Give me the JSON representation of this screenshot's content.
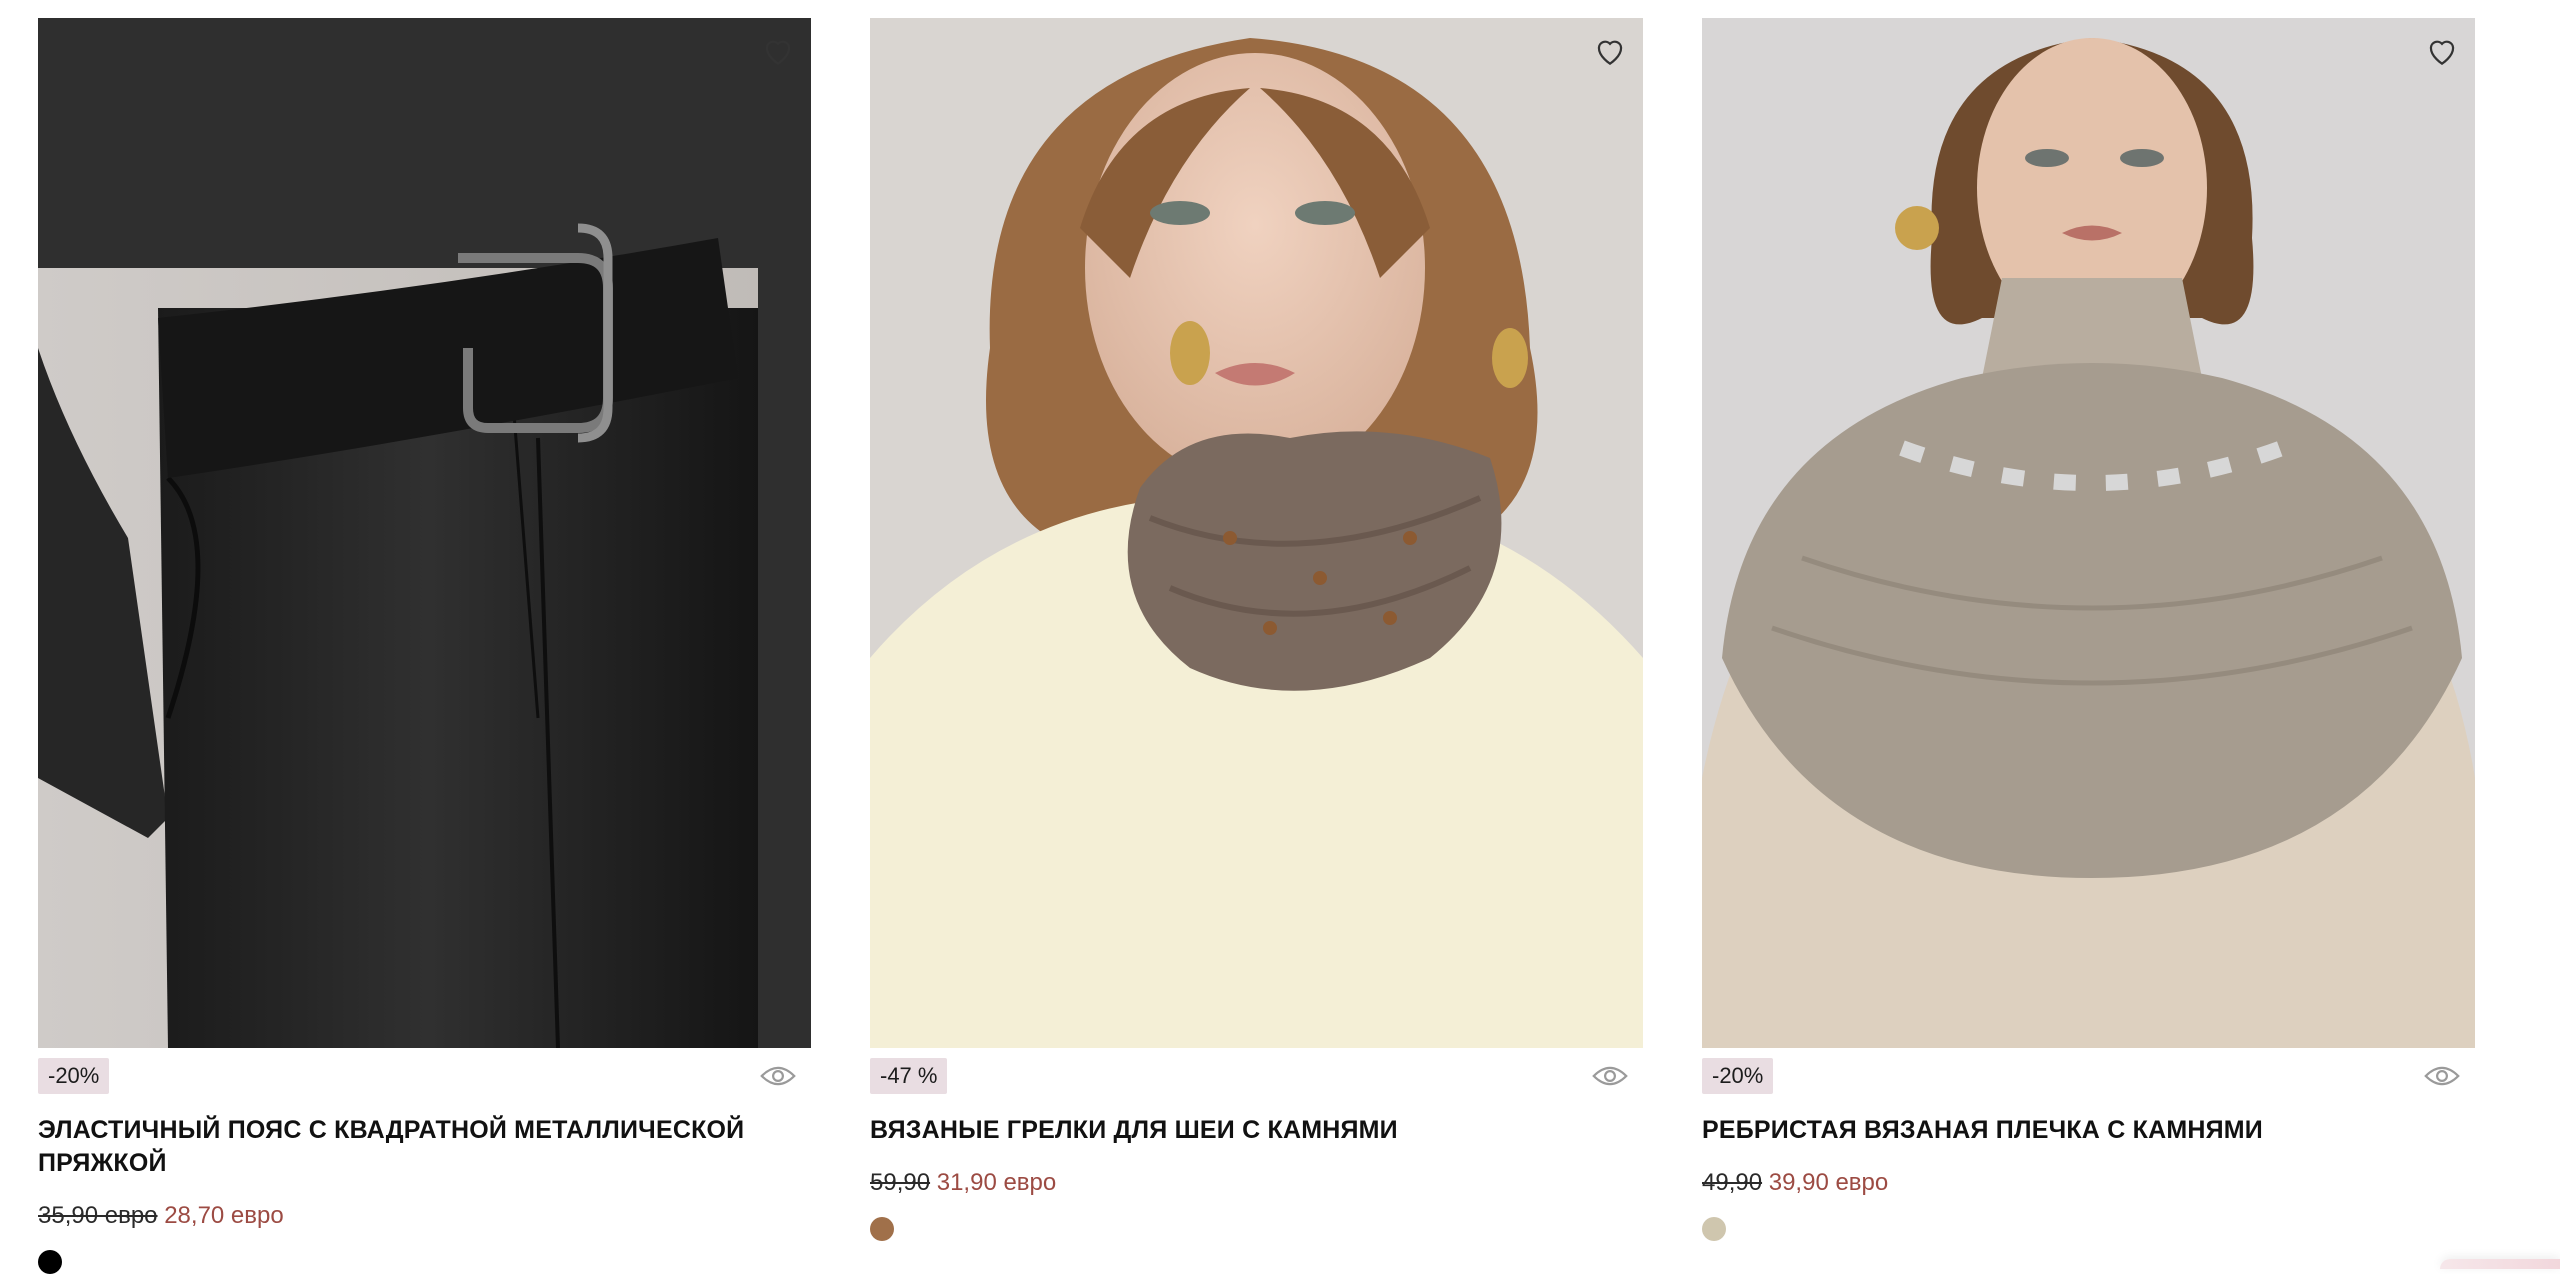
{
  "products": [
    {
      "badge": "-20%",
      "title": "ЭЛАСТИЧНЫЙ ПОЯС С КВАДРАТНОЙ МЕТАЛЛИЧЕСКОЙ ПРЯЖКОЙ",
      "old_price": "35,90 евро",
      "new_price": "28,70 евро",
      "swatch_color": "#000000",
      "image": "product-photo-belt"
    },
    {
      "badge": "-47 %",
      "title": "ВЯЗАНЫЕ ГРЕЛКИ ДЛЯ ШЕИ С КАМНЯМИ",
      "old_price": "59,90",
      "new_price": "31,90 евро",
      "swatch_color": "#a0704a",
      "image": "product-photo-neck-warmer"
    },
    {
      "badge": "-20%",
      "title": "РЕБРИСТАЯ ВЯЗАНАЯ ПЛЕЧКА С КАМНЯМИ",
      "old_price": "49,90",
      "new_price": "39,90 евро",
      "swatch_color": "#cfc6ae",
      "image": "product-photo-knit-cape"
    }
  ],
  "icons": {
    "favorite": "heart-icon",
    "quick_view": "eye-icon"
  },
  "colors": {
    "badge_bg": "#e9dde2",
    "sale_price": "#9c4b43",
    "old_price": "#2a2a2a"
  }
}
